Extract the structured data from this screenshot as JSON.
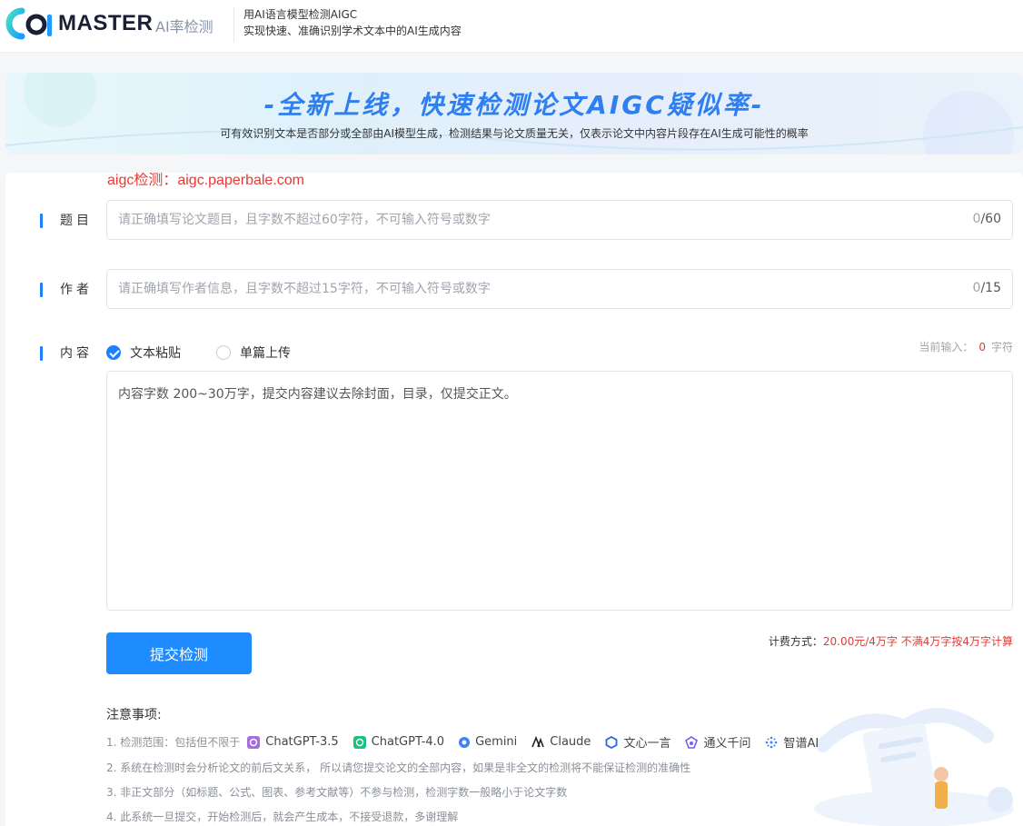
{
  "header": {
    "brand": "MASTER",
    "brand_sub": "AI率检测",
    "tagline_1": "用AI语言模型检测AIGC",
    "tagline_2": "实现快速、准确识别学术文本中的AI生成内容"
  },
  "banner": {
    "title": "-全新上线，快速检测论文AIGC疑似率-",
    "description": "可有效识别文本是否部分或全部由AI模型生成，检测结果与论文质量无关，仅表示论文中内容片段存在AI生成可能性的概率"
  },
  "watermark": "aigc检测：aigc.paperbale.com",
  "form": {
    "title_field": {
      "label": "题目",
      "placeholder": "请正确填写论文题目，且字数不超过60字符，不可输入符号或数字",
      "value": "",
      "count": "0",
      "max": "/60"
    },
    "author_field": {
      "label": "作者",
      "placeholder": "请正确填写作者信息，且字数不超过15字符，不可输入符号或数字",
      "value": "",
      "count": "0",
      "max": "/15"
    },
    "content_field": {
      "label": "内容",
      "mode_paste": "文本粘贴",
      "mode_upload": "单篇上传",
      "selected_mode": "paste",
      "current_input_label": "当前输入：",
      "current_input_count": "0",
      "current_input_unit": "字符",
      "placeholder": "内容字数 200~30万字，提交内容建议去除封面，目录，仅提交正文。"
    },
    "submit_label": "提交检测",
    "pricing_label": "计费方式：",
    "pricing_value": "20.00元/4万字 不满4万字按4万字计算"
  },
  "notes": {
    "title": "注意事项:",
    "line_1_prefix": "1. 检测范围：包括但不限于",
    "models": [
      {
        "name": "ChatGPT-3.5",
        "icon": "chatgpt-icon",
        "color": "#a86be0"
      },
      {
        "name": "ChatGPT-4.0",
        "icon": "chatgpt-icon",
        "color": "#19c37d"
      },
      {
        "name": "Gemini",
        "icon": "gemini-icon",
        "color": "#3b82f6"
      },
      {
        "name": "Claude",
        "icon": "claude-icon",
        "color": "#222222"
      },
      {
        "name": "文心一言",
        "icon": "wenxin-icon",
        "color": "#2563eb"
      },
      {
        "name": "通义千问",
        "icon": "tongyi-icon",
        "color": "#7c5cf5"
      },
      {
        "name": "智谱AI",
        "icon": "zhipu-icon",
        "color": "#3b82f6"
      }
    ],
    "line_2": "2. 系统在检测时会分析论文的前后文关系， 所以请您提交论文的全部内容，如果是非全文的检测将不能保证检测的准确性",
    "line_3": "3. 非正文部分（如标题、公式、图表、参考文献等）不参与检测，检测字数一般略小于论文字数",
    "line_4": "4. 此系统一旦提交，开始检测后，就会产生成本，不接受退款，多谢理解"
  },
  "colors": {
    "accent": "#1e80ff",
    "warning": "#e53935",
    "banner_title": "#2f7ff0"
  }
}
